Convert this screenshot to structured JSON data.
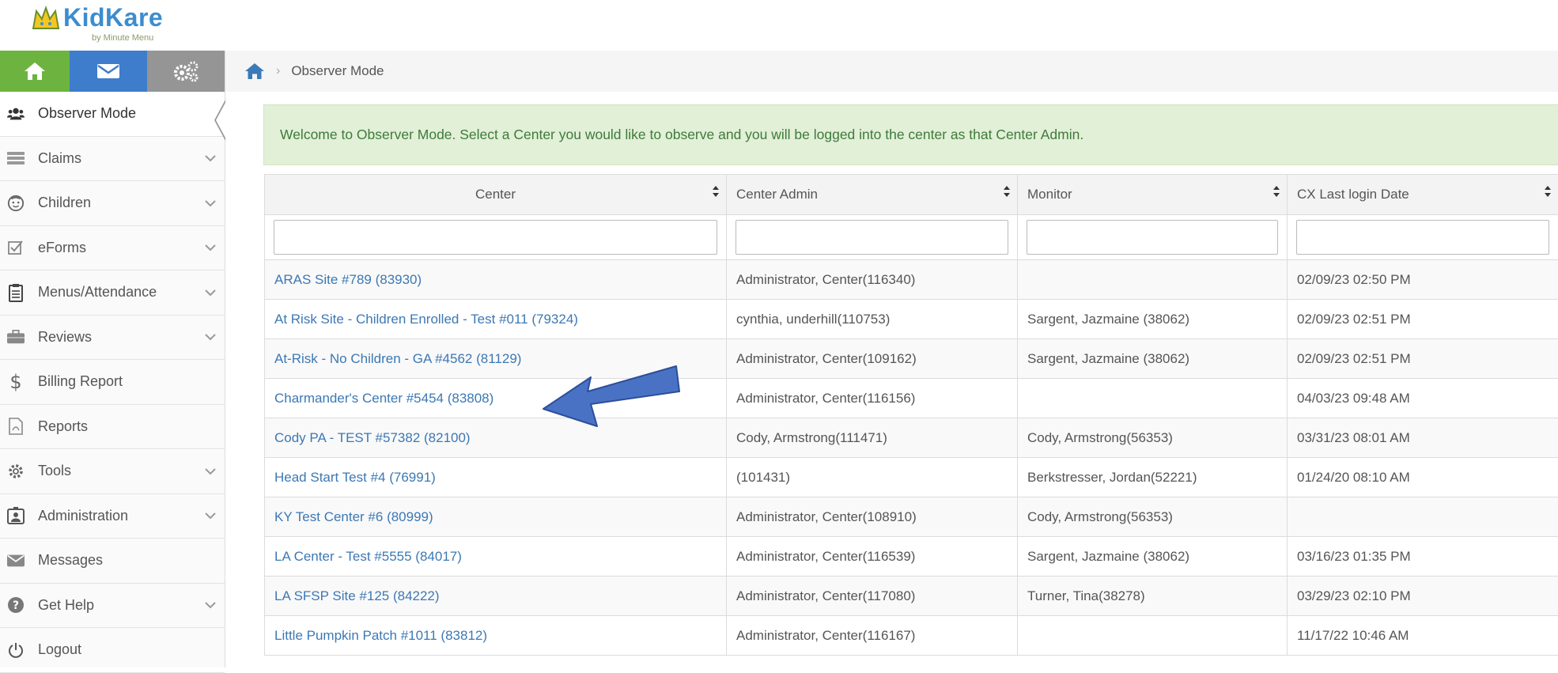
{
  "logo": {
    "brand": "KidKare",
    "tagline": "by Minute Menu"
  },
  "quick_buttons": [
    {
      "icon": "home-icon",
      "color": "#6db33f"
    },
    {
      "icon": "mail-icon",
      "color": "#3d7dcc"
    },
    {
      "icon": "gears-icon",
      "color": "#959595"
    }
  ],
  "sidebar": {
    "items": [
      {
        "label": "Observer Mode",
        "icon": "users-icon",
        "has_chevron": false
      },
      {
        "label": "Claims",
        "icon": "claims-icon",
        "has_chevron": true
      },
      {
        "label": "Children",
        "icon": "child-face-icon",
        "has_chevron": true
      },
      {
        "label": "eForms",
        "icon": "checkbox-icon",
        "has_chevron": true
      },
      {
        "label": "Menus/Attendance",
        "icon": "clipboard-icon",
        "has_chevron": true
      },
      {
        "label": "Reviews",
        "icon": "briefcase-icon",
        "has_chevron": true
      },
      {
        "label": "Billing Report",
        "icon": "dollar-icon",
        "has_chevron": false
      },
      {
        "label": "Reports",
        "icon": "pdf-file-icon",
        "has_chevron": false
      },
      {
        "label": "Tools",
        "icon": "cog-icon",
        "has_chevron": true
      },
      {
        "label": "Administration",
        "icon": "admin-badge-icon",
        "has_chevron": true
      },
      {
        "label": "Messages",
        "icon": "envelope-icon",
        "has_chevron": false
      },
      {
        "label": "Get Help",
        "icon": "question-icon",
        "has_chevron": true
      },
      {
        "label": "Logout",
        "icon": "power-icon",
        "has_chevron": false
      }
    ]
  },
  "breadcrumb": {
    "current": "Observer Mode"
  },
  "alert": {
    "text": "Welcome to Observer Mode. Select a Center you would like to observe and you will be logged into the center as that Center Admin."
  },
  "table": {
    "columns": [
      "Center",
      "Center Admin",
      "Monitor",
      "CX Last login Date"
    ],
    "rows": [
      [
        "ARAS Site #789 (83930)",
        "Administrator, Center(116340)",
        "",
        "02/09/23 02:50 PM"
      ],
      [
        "At Risk Site - Children Enrolled - Test #011 (79324)",
        "cynthia, underhill(110753)",
        "Sargent, Jazmaine (38062)",
        "02/09/23 02:51 PM"
      ],
      [
        "At-Risk - No Children - GA #4562 (81129)",
        "Administrator, Center(109162)",
        "Sargent, Jazmaine (38062)",
        "02/09/23 02:51 PM"
      ],
      [
        "Charmander's Center #5454 (83808)",
        "Administrator, Center(116156)",
        "",
        "04/03/23 09:48 AM"
      ],
      [
        "Cody PA - TEST #57382 (82100)",
        "Cody, Armstrong(111471)",
        "Cody, Armstrong(56353)",
        "03/31/23 08:01 AM"
      ],
      [
        "Head Start Test #4 (76991)",
        "(101431)",
        "Berkstresser, Jordan(52221)",
        "01/24/20 08:10 AM"
      ],
      [
        "KY Test Center #6 (80999)",
        "Administrator, Center(108910)",
        "Cody, Armstrong(56353)",
        ""
      ],
      [
        "LA Center - Test #5555 (84017)",
        "Administrator, Center(116539)",
        "Sargent, Jazmaine (38062)",
        "03/16/23 01:35 PM"
      ],
      [
        "LA SFSP Site #125 (84222)",
        "Administrator, Center(117080)",
        "Turner, Tina(38278)",
        "03/29/23 02:10 PM"
      ],
      [
        "Little Pumpkin Patch #1011 (83812)",
        "Administrator, Center(116167)",
        "",
        "11/17/22 10:46 AM"
      ]
    ]
  },
  "annotation": {
    "arrow_color": "#4a72c4",
    "points_to_row": 3
  }
}
